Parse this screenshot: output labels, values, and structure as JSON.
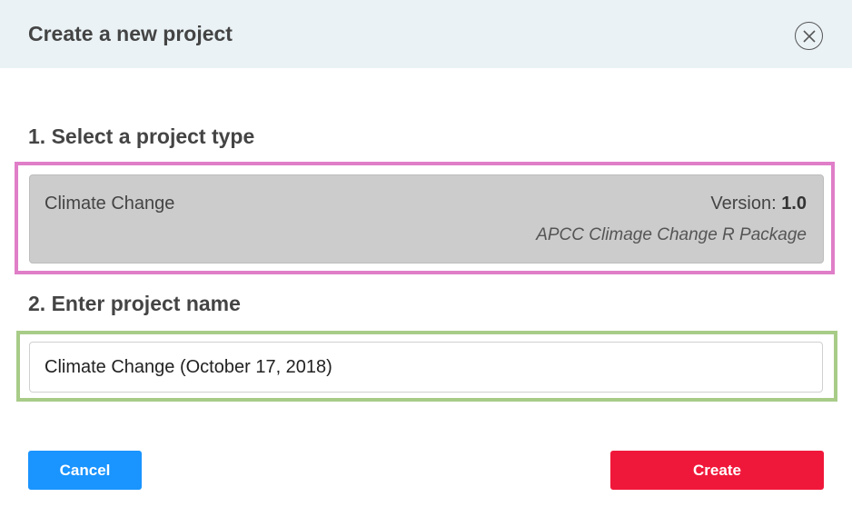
{
  "header": {
    "title": "Create a new project",
    "close_icon": "close-circle-icon"
  },
  "step1": {
    "title": "1. Select a project type",
    "project_type": {
      "name": "Climate Change",
      "version_label": "Version:",
      "version_value": "1.0",
      "description": "APCC Climage Change R Package",
      "selected": true
    }
  },
  "step2": {
    "title": "2. Enter project name",
    "project_name_value": "Climate Change (October 17, 2018)"
  },
  "footer": {
    "cancel_label": "Cancel",
    "create_label": "Create"
  },
  "colors": {
    "header_bg": "#eaf2f5",
    "card_bg": "#cccccc",
    "cancel_bg": "#1a94ff",
    "create_bg": "#f0183a",
    "highlight_pink": "#e07ec8",
    "highlight_green": "#a8cc88"
  }
}
